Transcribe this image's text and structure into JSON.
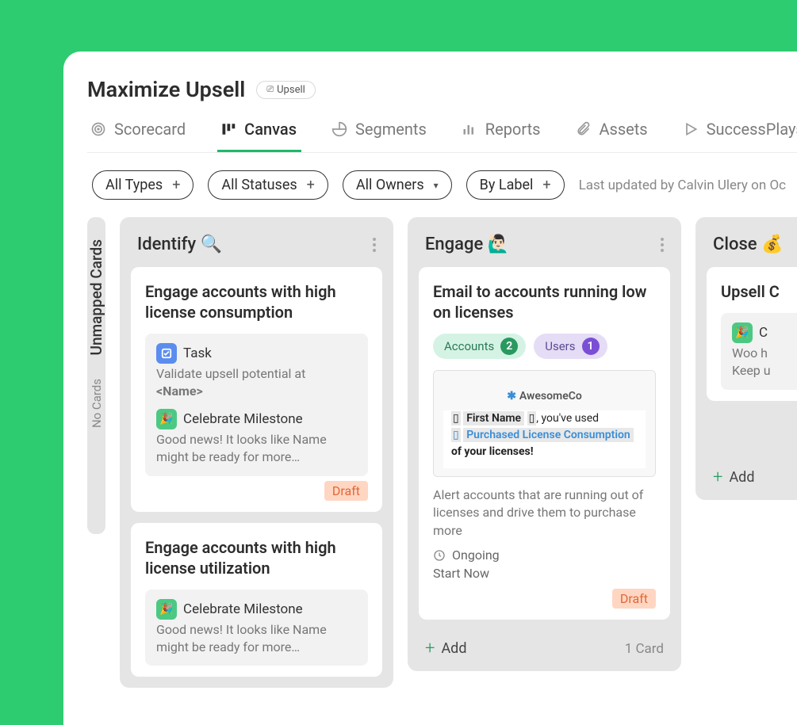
{
  "header": {
    "title": "Maximize Upsell",
    "tag_icon": "$",
    "tag_label": "Upsell"
  },
  "tabs": [
    {
      "id": "scorecard",
      "label": "Scorecard",
      "icon": "target-icon"
    },
    {
      "id": "canvas",
      "label": "Canvas",
      "icon": "board-icon",
      "active": true
    },
    {
      "id": "segments",
      "label": "Segments",
      "icon": "pie-icon"
    },
    {
      "id": "reports",
      "label": "Reports",
      "icon": "bar-icon"
    },
    {
      "id": "assets",
      "label": "Assets",
      "icon": "clip-icon"
    },
    {
      "id": "successplays",
      "label": "SuccessPlays",
      "icon": "play-icon"
    }
  ],
  "filters": {
    "types": "All Types",
    "statuses": "All Statuses",
    "owners": "All Owners",
    "label": "By Label",
    "last_updated": "Last updated by Calvin Ulery on Oc"
  },
  "side": {
    "title": "Unmapped Cards",
    "subtitle": "No Cards"
  },
  "columns": [
    {
      "id": "identify",
      "title": "Identify 🔍",
      "cards": [
        {
          "id": "c1",
          "title": "Engage accounts with high license consumption",
          "items": [
            {
              "icon": "task",
              "label": "Task",
              "text": "Validate upsell potential at",
              "bold": "<Name>"
            },
            {
              "icon": "celebrate",
              "label": "Celebrate Milestone",
              "text": "Good news! It looks like  Name might be ready for more…"
            }
          ],
          "status": "Draft"
        },
        {
          "id": "c2",
          "title": "Engage accounts with high license utilization",
          "items": [
            {
              "icon": "celebrate",
              "label": "Celebrate Milestone",
              "text": "Good news! It looks like  Name might be ready for more…"
            }
          ]
        }
      ]
    },
    {
      "id": "engage",
      "title": "Engage 🙋🏻‍♂️",
      "cards": [
        {
          "id": "c3",
          "title": "Email to accounts running low on licenses",
          "chips": [
            {
              "label": "Accounts",
              "count": "2",
              "type": "accounts"
            },
            {
              "label": "Users",
              "count": "1",
              "type": "users"
            }
          ],
          "email_preview": {
            "logo": "AwesomeCo",
            "line1_ph": "First Name",
            "line1_suffix": ", you've used",
            "line2_link": "Purchased License Consumption",
            "line3": "of your licenses!"
          },
          "desc": "Alert accounts that are running out of licenses and drive them to purchase more",
          "meta_time": "Ongoing",
          "meta_action": "Start Now",
          "status": "Draft"
        }
      ],
      "footer": {
        "add": "Add",
        "count": "1 Card"
      }
    },
    {
      "id": "close",
      "title": "Close 💰",
      "cards": [
        {
          "id": "c4",
          "title": "Upsell C",
          "items": [
            {
              "icon": "celebrate",
              "label": "C",
              "text": "Woo h\nKeep u"
            }
          ]
        }
      ],
      "footer": {
        "add": "Add"
      }
    }
  ]
}
